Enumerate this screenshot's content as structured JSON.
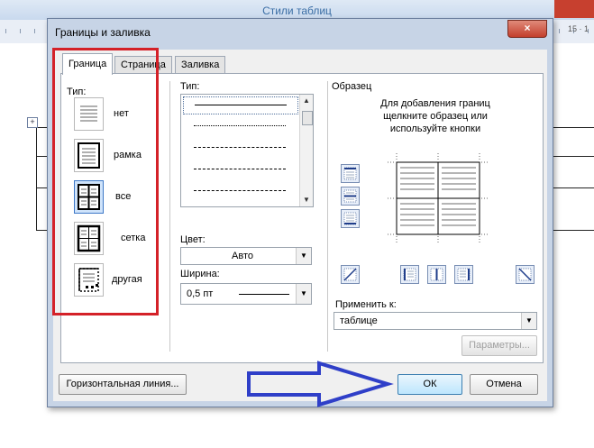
{
  "background": {
    "window_title": "Стили таблиц",
    "ruler_number": "15 · 1"
  },
  "dialog": {
    "title": "Границы и заливка",
    "close_glyph": "×",
    "tabs": [
      {
        "label": "Граница",
        "active": true
      },
      {
        "label": "Страница",
        "active": false
      },
      {
        "label": "Заливка",
        "active": false
      }
    ],
    "type_label": "Тип:",
    "presets": [
      {
        "label": "нет",
        "icon": "no-border-icon",
        "selected": false
      },
      {
        "label": "рамка",
        "icon": "box-border-icon",
        "selected": false
      },
      {
        "label": "все",
        "icon": "all-borders-icon",
        "selected": true
      },
      {
        "label": "сетка",
        "icon": "grid-border-icon",
        "selected": false
      },
      {
        "label": "другая",
        "icon": "custom-border-icon",
        "selected": false
      }
    ],
    "line_type_label": "Тип:",
    "line_styles": [
      "solid",
      "dotted",
      "dashed-small",
      "dashed",
      "dash-dot"
    ],
    "color_label": "Цвет:",
    "color_value": "Авто",
    "width_label": "Ширина:",
    "width_value": "0,5 пт",
    "preview_label": "Образец",
    "preview_hint": "Для добавления границ щелкните образец или используйте кнопки",
    "apply_label": "Применить к:",
    "apply_value": "таблице",
    "params_button": "Параметры...",
    "horizontal_line_button": "Горизонтальная линия...",
    "ok_button": "ОК",
    "cancel_button": "Отмена"
  },
  "annotation_colors": {
    "red_frame": "#d42128",
    "blue_arrow": "#2f3fc8"
  }
}
